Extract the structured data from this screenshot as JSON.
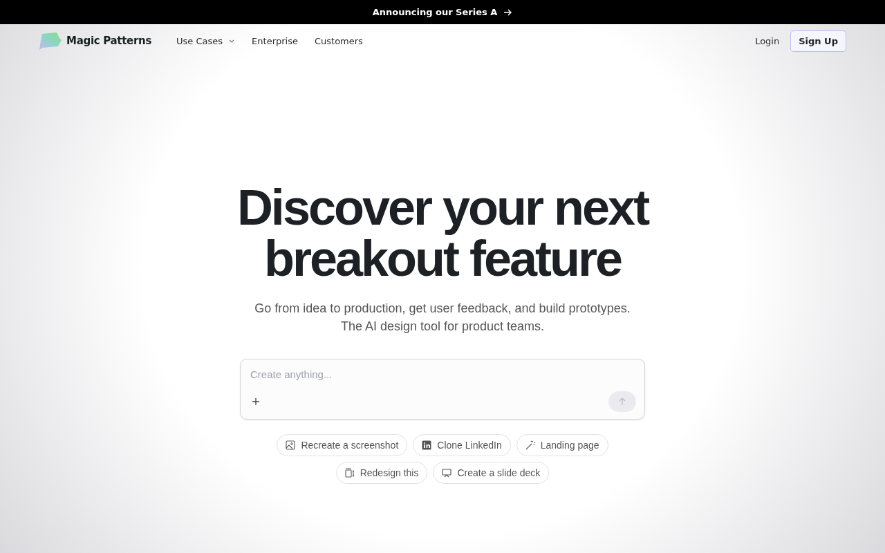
{
  "banner": {
    "text": "Announcing our Series A"
  },
  "nav": {
    "brand": "Magic Patterns",
    "links": [
      {
        "label": "Use Cases",
        "dropdown": true
      },
      {
        "label": "Enterprise",
        "dropdown": false
      },
      {
        "label": "Customers",
        "dropdown": false
      }
    ],
    "login": "Login",
    "signup": "Sign Up"
  },
  "hero": {
    "title_lines": [
      "Discover your next",
      "breakout feature"
    ],
    "subtitle_lines": [
      "Go from idea to production, get user feedback, and build prototypes.",
      "The AI design tool for product teams."
    ]
  },
  "prompt": {
    "placeholder": "Create anything..."
  },
  "suggestions": [
    [
      {
        "label": "Recreate a screenshot",
        "kind": "image"
      },
      {
        "label": "Clone LinkedIn",
        "kind": "linkedin"
      },
      {
        "label": "Landing page",
        "kind": "wand"
      }
    ],
    [
      {
        "label": "Redesign this",
        "kind": "redesign"
      },
      {
        "label": "Create a slide deck",
        "kind": "presentation"
      }
    ]
  ]
}
